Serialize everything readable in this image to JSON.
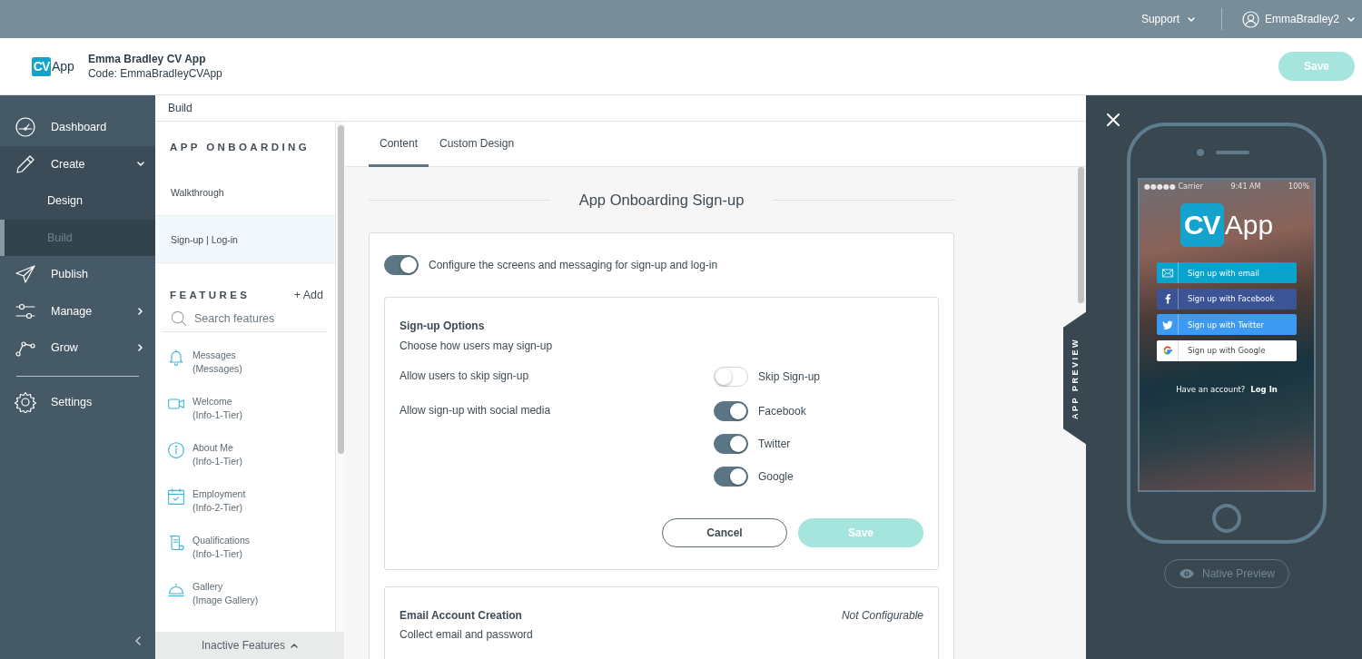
{
  "top_bar": {
    "support": "Support",
    "user": "EmmaBradley2"
  },
  "header": {
    "logo": {
      "mark": "CV",
      "text": "App"
    },
    "app_name": "Emma Bradley CV App",
    "code": "Code: EmmaBradleyCVApp",
    "save": {
      "label": "Save",
      "disabled": true
    }
  },
  "nav": {
    "items": [
      {
        "label": "Dashboard",
        "selected": false
      },
      {
        "label": "Create",
        "selected": false,
        "expanded": true,
        "children": [
          {
            "label": "Design",
            "selected": false
          },
          {
            "label": "Build",
            "selected": true
          }
        ]
      },
      {
        "label": "Publish",
        "selected": false
      },
      {
        "label": "Manage",
        "selected": false,
        "expanded": false
      },
      {
        "label": "Grow",
        "selected": false,
        "expanded": false
      },
      {
        "label": "Settings",
        "selected": false
      }
    ]
  },
  "breadcrumb": "Build",
  "onboarding": {
    "heading": "APP ONBOARDING",
    "items": [
      {
        "label": "Walkthrough",
        "selected": false
      },
      {
        "label": "Sign-up | Log-in",
        "selected": true
      }
    ]
  },
  "features": {
    "heading": "FEATURES",
    "add": "+ Add",
    "search_placeholder": "Search features",
    "items": [
      {
        "name": "Messages",
        "type": "(Messages)"
      },
      {
        "name": "Welcome",
        "type": "(Info-1-Tier)"
      },
      {
        "name": "About Me",
        "type": "(Info-1-Tier)"
      },
      {
        "name": "Employment",
        "type": "(Info-2-Tier)"
      },
      {
        "name": "Qualifications",
        "type": "(Info-1-Tier)"
      },
      {
        "name": "Gallery",
        "type": "(Image Gallery)"
      }
    ],
    "inactive": "Inactive Features"
  },
  "tabs": [
    {
      "label": "Content",
      "selected": true
    },
    {
      "label": "Custom Design",
      "selected": false
    }
  ],
  "section_title": "App Onboarding Sign-up",
  "master_toggle": {
    "label": "Configure the screens and messaging for sign-up and log-in",
    "on": true
  },
  "signup_options": {
    "title": "Sign-up Options",
    "subtitle": "Choose how users may sign-up",
    "rows": [
      {
        "label": "Allow users to skip sign-up",
        "toggles": [
          {
            "label": "Skip Sign-up",
            "on": false
          }
        ]
      },
      {
        "label": "Allow sign-up with social media",
        "toggles": [
          {
            "label": "Facebook",
            "on": true
          },
          {
            "label": "Twitter",
            "on": true
          },
          {
            "label": "Google",
            "on": true
          }
        ]
      }
    ],
    "cancel": "Cancel",
    "save": {
      "label": "Save",
      "disabled": true
    }
  },
  "email_card": {
    "title": "Email Account Creation",
    "subtitle": "Collect email and password",
    "status": "Not Configurable"
  },
  "preview": {
    "tab": "APP PREVIEW",
    "status_bar": {
      "carrier": "●●●●● Carrier",
      "time": "9:41 AM",
      "battery": "100%"
    },
    "logo": {
      "mark": "CV",
      "text": "App"
    },
    "signup_buttons": [
      {
        "label": "Sign up with email",
        "kind": "email",
        "color": "#0aa3cb"
      },
      {
        "label": "Sign up with Facebook",
        "kind": "facebook",
        "color": "#3b5496"
      },
      {
        "label": "Sign up with Twitter",
        "kind": "twitter",
        "color": "#3d9af2"
      },
      {
        "label": "Sign up with Google",
        "kind": "google",
        "color": "#ffffff"
      }
    ],
    "account_prompt": "Have an account?",
    "login": "Log In",
    "native_preview": "Native Preview"
  }
}
